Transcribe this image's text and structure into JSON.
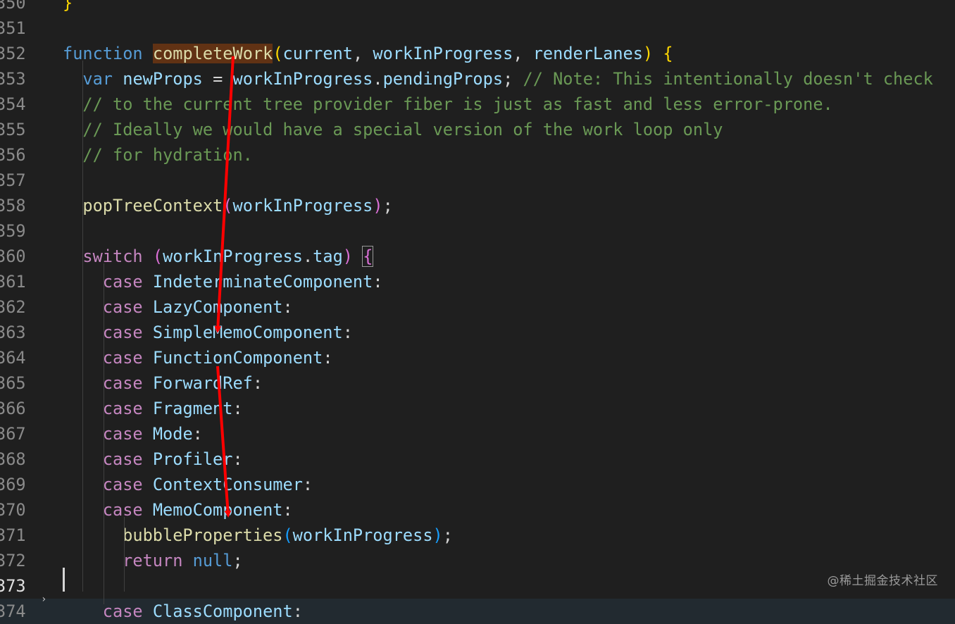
{
  "editor": {
    "lines": [
      {
        "n": "350",
        "segments": [
          {
            "i": 0
          },
          {
            "t": "}",
            "c": "b1"
          }
        ]
      },
      {
        "n": "351",
        "segments": []
      },
      {
        "n": "352",
        "segments": [
          {
            "t": "function",
            "c": "k1"
          },
          {
            "t": " ",
            "c": "pn"
          },
          {
            "t": "completeWork",
            "c": "fn hl"
          },
          {
            "t": "(",
            "c": "b1"
          },
          {
            "t": "current",
            "c": "vr"
          },
          {
            "t": ", ",
            "c": "pn"
          },
          {
            "t": "workInProgress",
            "c": "vr"
          },
          {
            "t": ", ",
            "c": "pn"
          },
          {
            "t": "renderLanes",
            "c": "vr"
          },
          {
            "t": ")",
            "c": "b1"
          },
          {
            "t": " ",
            "c": "pn"
          },
          {
            "t": "{",
            "c": "b1"
          }
        ]
      },
      {
        "n": "353",
        "segments": [
          {
            "i": 1
          },
          {
            "t": "var",
            "c": "k1"
          },
          {
            "t": " ",
            "c": "pn"
          },
          {
            "t": "newProps",
            "c": "vr"
          },
          {
            "t": " = ",
            "c": "pn"
          },
          {
            "t": "workInProgress",
            "c": "vr"
          },
          {
            "t": ".",
            "c": "pn"
          },
          {
            "t": "pendingProps",
            "c": "vr"
          },
          {
            "t": "; ",
            "c": "pn"
          },
          {
            "t": "// Note: This intentionally doesn't check",
            "c": "cm"
          }
        ]
      },
      {
        "n": "354",
        "segments": [
          {
            "i": 1
          },
          {
            "t": "// to the current tree provider fiber is just as fast and less error-prone.",
            "c": "cm"
          }
        ]
      },
      {
        "n": "355",
        "segments": [
          {
            "i": 1
          },
          {
            "t": "// Ideally we would have a special version of the work loop only",
            "c": "cm"
          }
        ]
      },
      {
        "n": "356",
        "segments": [
          {
            "i": 1
          },
          {
            "t": "// for hydration.",
            "c": "cm"
          }
        ]
      },
      {
        "n": "357",
        "segments": []
      },
      {
        "n": "358",
        "segments": [
          {
            "i": 1
          },
          {
            "t": "popTreeContext",
            "c": "fn"
          },
          {
            "t": "(",
            "c": "b2"
          },
          {
            "t": "workInProgress",
            "c": "vr"
          },
          {
            "t": ")",
            "c": "b2"
          },
          {
            "t": ";",
            "c": "pn"
          }
        ]
      },
      {
        "n": "359",
        "segments": []
      },
      {
        "n": "360",
        "segments": [
          {
            "i": 1
          },
          {
            "t": "switch",
            "c": "k2"
          },
          {
            "t": " ",
            "c": "pn"
          },
          {
            "t": "(",
            "c": "b2"
          },
          {
            "t": "workInProgress",
            "c": "vr"
          },
          {
            "t": ".",
            "c": "pn"
          },
          {
            "t": "tag",
            "c": "vr"
          },
          {
            "t": ")",
            "c": "b2"
          },
          {
            "t": " ",
            "c": "pn"
          },
          {
            "t": "{",
            "c": "b2 br-box"
          }
        ]
      },
      {
        "n": "361",
        "segments": [
          {
            "i": 2
          },
          {
            "t": "case",
            "c": "k2"
          },
          {
            "t": " ",
            "c": "pn"
          },
          {
            "t": "IndeterminateComponent",
            "c": "vr"
          },
          {
            "t": ":",
            "c": "pn"
          }
        ]
      },
      {
        "n": "362",
        "segments": [
          {
            "i": 2
          },
          {
            "t": "case",
            "c": "k2"
          },
          {
            "t": " ",
            "c": "pn"
          },
          {
            "t": "LazyComponent",
            "c": "vr"
          },
          {
            "t": ":",
            "c": "pn"
          }
        ]
      },
      {
        "n": "363",
        "segments": [
          {
            "i": 2
          },
          {
            "t": "case",
            "c": "k2"
          },
          {
            "t": " ",
            "c": "pn"
          },
          {
            "t": "SimpleMemoComponent",
            "c": "vr"
          },
          {
            "t": ":",
            "c": "pn"
          }
        ]
      },
      {
        "n": "364",
        "segments": [
          {
            "i": 2
          },
          {
            "t": "case",
            "c": "k2"
          },
          {
            "t": " ",
            "c": "pn"
          },
          {
            "t": "FunctionComponent",
            "c": "vr"
          },
          {
            "t": ":",
            "c": "pn"
          }
        ]
      },
      {
        "n": "365",
        "segments": [
          {
            "i": 2
          },
          {
            "t": "case",
            "c": "k2"
          },
          {
            "t": " ",
            "c": "pn"
          },
          {
            "t": "ForwardRef",
            "c": "vr"
          },
          {
            "t": ":",
            "c": "pn"
          }
        ]
      },
      {
        "n": "366",
        "segments": [
          {
            "i": 2
          },
          {
            "t": "case",
            "c": "k2"
          },
          {
            "t": " ",
            "c": "pn"
          },
          {
            "t": "Fragment",
            "c": "vr"
          },
          {
            "t": ":",
            "c": "pn"
          }
        ]
      },
      {
        "n": "367",
        "segments": [
          {
            "i": 2
          },
          {
            "t": "case",
            "c": "k2"
          },
          {
            "t": " ",
            "c": "pn"
          },
          {
            "t": "Mode",
            "c": "vr"
          },
          {
            "t": ":",
            "c": "pn"
          }
        ]
      },
      {
        "n": "368",
        "segments": [
          {
            "i": 2
          },
          {
            "t": "case",
            "c": "k2"
          },
          {
            "t": " ",
            "c": "pn"
          },
          {
            "t": "Profiler",
            "c": "vr"
          },
          {
            "t": ":",
            "c": "pn"
          }
        ]
      },
      {
        "n": "369",
        "segments": [
          {
            "i": 2
          },
          {
            "t": "case",
            "c": "k2"
          },
          {
            "t": " ",
            "c": "pn"
          },
          {
            "t": "ContextConsumer",
            "c": "vr"
          },
          {
            "t": ":",
            "c": "pn"
          }
        ]
      },
      {
        "n": "370",
        "segments": [
          {
            "i": 2
          },
          {
            "t": "case",
            "c": "k2"
          },
          {
            "t": " ",
            "c": "pn"
          },
          {
            "t": "MemoComponent",
            "c": "vr"
          },
          {
            "t": ":",
            "c": "pn"
          }
        ]
      },
      {
        "n": "371",
        "segments": [
          {
            "i": 3
          },
          {
            "t": "bubbleProperties",
            "c": "fn"
          },
          {
            "t": "(",
            "c": "b3"
          },
          {
            "t": "workInProgress",
            "c": "vr"
          },
          {
            "t": ")",
            "c": "b3"
          },
          {
            "t": ";",
            "c": "pn"
          }
        ]
      },
      {
        "n": "372",
        "segments": [
          {
            "i": 3
          },
          {
            "t": "return",
            "c": "k2"
          },
          {
            "t": " ",
            "c": "pn"
          },
          {
            "t": "null",
            "c": "k1"
          },
          {
            "t": ";",
            "c": "pn"
          }
        ]
      },
      {
        "n": "373",
        "segments": [],
        "active": true
      },
      {
        "n": "374",
        "segments": [
          {
            "i": 2
          },
          {
            "t": "case",
            "c": "k2"
          },
          {
            "t": " ",
            "c": "pn"
          },
          {
            "t": "ClassComponent",
            "c": "vr"
          },
          {
            "t": ":",
            "c": "pn"
          }
        ],
        "current": true
      }
    ]
  },
  "watermark": "@稀土掘金技术社区",
  "annotation_color": "#ff0000",
  "icons": {
    "fold": "chevron-right-icon"
  }
}
